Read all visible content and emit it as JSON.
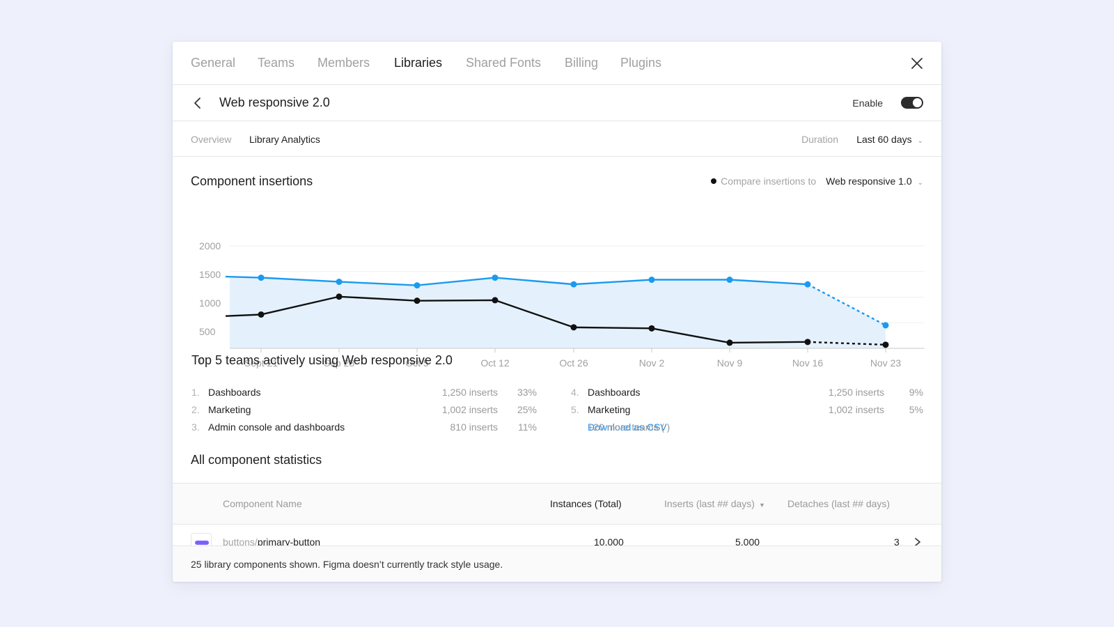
{
  "tabs": [
    "General",
    "Teams",
    "Members",
    "Libraries",
    "Shared Fonts",
    "Billing",
    "Plugins"
  ],
  "active_tab": "Libraries",
  "library": {
    "title": "Web responsive 2.0",
    "enable_label": "Enable",
    "enabled": true
  },
  "subnav": {
    "overview": "Overview",
    "analytics": "Library Analytics",
    "duration_label": "Duration",
    "duration_value": "Last 60 days"
  },
  "insertions": {
    "title": "Component insertions",
    "compare_label": "Compare insertions to",
    "compare_value": "Web responsive 1.0"
  },
  "chart_data": {
    "type": "area",
    "categories": [
      "Sept 21",
      "Sep 28",
      "Oct 5",
      "Oct 12",
      "Oct 26",
      "Nov 2",
      "Nov 9",
      "Nov 16",
      "Nov 23"
    ],
    "ylim": [
      0,
      2000
    ],
    "yticks": [
      "2000",
      "1500",
      "1000",
      "500",
      "0"
    ],
    "grid": true,
    "projected_from_index": 7,
    "series": [
      {
        "key": "primary",
        "color": "#1a9af0",
        "fill": "#e4f1fd",
        "start": 1400,
        "values": [
          1380,
          1300,
          1230,
          1380,
          1250,
          1340,
          1340,
          1250,
          450
        ]
      },
      {
        "key": "compare",
        "color": "#111111",
        "start": 630,
        "values": [
          660,
          1010,
          930,
          940,
          410,
          390,
          110,
          125,
          70
        ]
      }
    ]
  },
  "top_teams": {
    "title": "Top 5 teams actively using Web responsive 2.0",
    "left": [
      {
        "rank": "1.",
        "name": "Dashboards",
        "inserts": "1,250 inserts",
        "pct": "33%"
      },
      {
        "rank": "2.",
        "name": "Marketing",
        "inserts": "1,002 inserts",
        "pct": "25%"
      },
      {
        "rank": "3.",
        "name": "Admin console and dashboards",
        "inserts": "810 inserts",
        "pct": "11%"
      }
    ],
    "right": [
      {
        "rank": "4.",
        "name": "Dashboards",
        "inserts": "1,250 inserts",
        "pct": "9%"
      },
      {
        "rank": "5.",
        "name": "Marketing",
        "inserts": "1,002 inserts",
        "pct": "5%"
      }
    ],
    "more_prefix": "+20 more teams (",
    "more_link": "Download as CSV",
    "more_suffix": ")"
  },
  "stats": {
    "title": "All component statistics",
    "columns": [
      "Component Name",
      "Instances (Total)",
      "Inserts (last ## days)",
      "Detaches (last ## days)"
    ],
    "sort_icon": "caret-down-icon",
    "rows": [
      {
        "folder": "buttons/",
        "name": "primary-button",
        "instances": "10,000",
        "inserts": "5,000",
        "detaches": "3"
      }
    ]
  },
  "footer": "25 library components shown. Figma doesn’t currently track style usage."
}
